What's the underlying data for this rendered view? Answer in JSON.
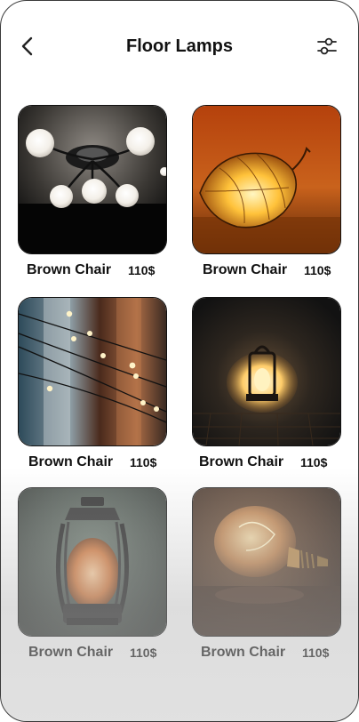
{
  "header": {
    "title": "Floor Lamps",
    "back_icon": "chevron-left-icon",
    "filter_icon": "sliders-icon"
  },
  "products": [
    {
      "name": "Brown Chair",
      "price": "110$",
      "image": "ceiling-globe-lamp"
    },
    {
      "name": "Brown Chair",
      "price": "110$",
      "image": "glowing-lantern-pod"
    },
    {
      "name": "Brown Chair",
      "price": "110$",
      "image": "string-lights"
    },
    {
      "name": "Brown Chair",
      "price": "110$",
      "image": "lantern-on-pavement"
    },
    {
      "name": "Brown Chair",
      "price": "110$",
      "image": "rusty-oil-lantern"
    },
    {
      "name": "Brown Chair",
      "price": "110$",
      "image": "edison-bulb"
    }
  ]
}
